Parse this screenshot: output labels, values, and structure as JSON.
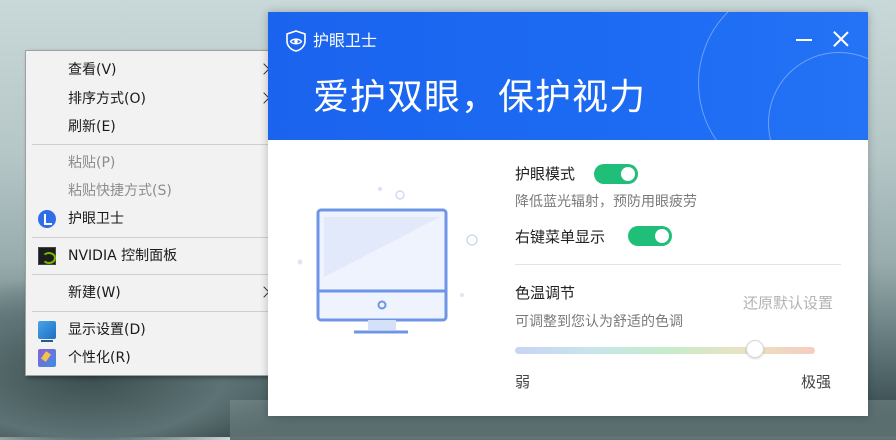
{
  "context_menu": {
    "items": [
      {
        "label": "查看(V)"
      },
      {
        "label": "排序方式(O)"
      },
      {
        "label": "刷新(E)"
      },
      {
        "label": "粘贴(P)"
      },
      {
        "label": "粘贴快捷方式(S)"
      },
      {
        "label": "护眼卫士"
      },
      {
        "label": "NVIDIA 控制面板"
      },
      {
        "label": "新建(W)"
      },
      {
        "label": "显示设置(D)"
      },
      {
        "label": "个性化(R)"
      }
    ]
  },
  "dialog": {
    "app_title": "护眼卫士",
    "slogan": "爱护双眼，保护视力",
    "eye_mode": {
      "label": "护眼模式",
      "enabled": true,
      "description": "降低蓝光辐射，预防用眼疲劳"
    },
    "context_menu_display": {
      "label": "右键菜单显示",
      "enabled": true
    },
    "color_temp": {
      "title": "色温调节",
      "reset_label": "还原默认设置",
      "description": "可调整到您认为舒适的色调",
      "slider_value_fraction": 0.8,
      "min_label": "弱",
      "max_label": "极强"
    },
    "accent_color": "#1a66f0",
    "toggle_color": "#1fbf7a"
  }
}
